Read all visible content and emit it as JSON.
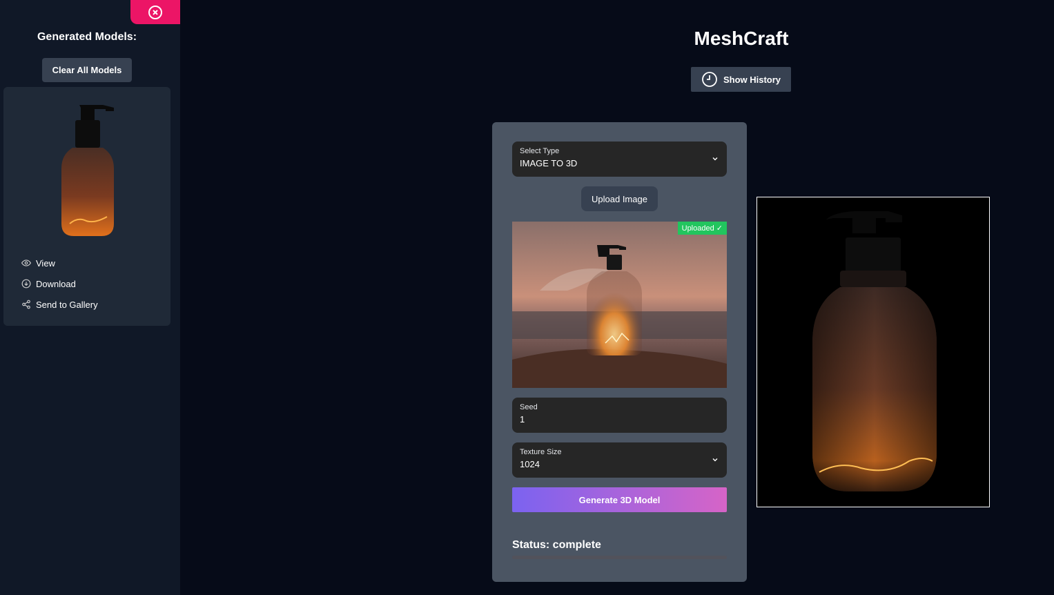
{
  "sidebar": {
    "title": "Generated Models:",
    "clear_label": "Clear All Models",
    "close_icon": "close-circle-icon",
    "card": {
      "actions": [
        {
          "label": "View",
          "icon": "eye-icon"
        },
        {
          "label": "Download",
          "icon": "download-circle-icon"
        },
        {
          "label": "Send to Gallery",
          "icon": "share-icon"
        }
      ]
    }
  },
  "header": {
    "title": "MeshCraft",
    "history_label": "Show History",
    "history_icon": "clock-icon"
  },
  "form": {
    "type_label": "Select Type",
    "type_value": "IMAGE TO 3D",
    "upload_label": "Upload Image",
    "uploaded_badge": "Uploaded ✓",
    "seed_label": "Seed",
    "seed_value": "1",
    "texture_label": "Texture Size",
    "texture_value": "1024",
    "generate_label": "Generate 3D Model",
    "status_text": "Status: complete",
    "progress": 1.0
  },
  "colors": {
    "background": "#060b18",
    "sidebar": "#101827",
    "close_button": "#ec1566",
    "badge": "#22c55e",
    "gradient_start": "#7b63f0",
    "gradient_end": "#d664c7"
  }
}
